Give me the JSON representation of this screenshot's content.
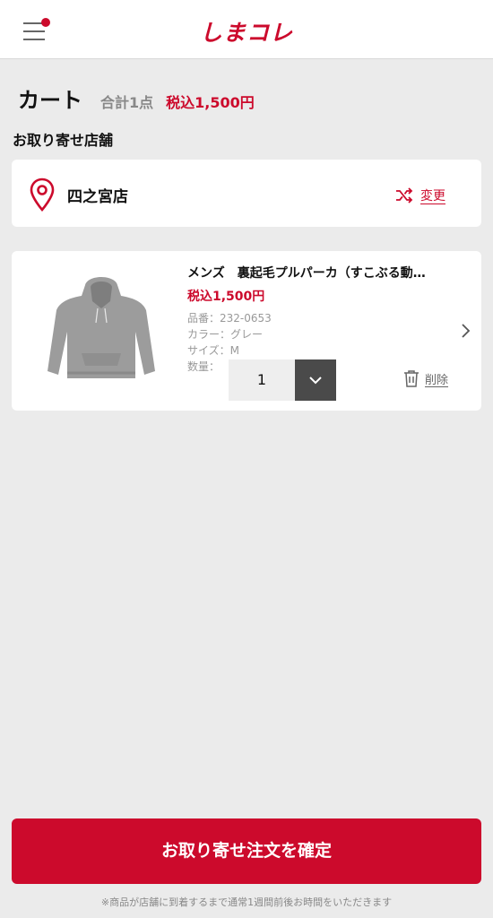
{
  "header": {
    "logo": "しまコレ",
    "menu_icon": "hamburger-menu-icon",
    "notification_dot_color": "#cc0a2c"
  },
  "cart": {
    "title": "カート",
    "count": "合計1点",
    "total": "税込1,500円"
  },
  "store_section": {
    "label": "お取り寄せ店舗",
    "store_name": "四之宮店",
    "change_label": "変更",
    "pin_icon": "location-pin-icon",
    "change_icon": "shuffle-icon"
  },
  "item": {
    "name": "メンズ　裏起毛プルパーカ（すこぶる動…",
    "price": "税込1,500円",
    "sku": "品番：232-0653",
    "color": "カラー：グレー",
    "size": "サイズ：M",
    "qty_label": "数量：",
    "qty_value": "1",
    "delete_label": "削除",
    "delete_icon": "trash-icon",
    "detail_icon": "chevron-right-icon"
  },
  "footer": {
    "confirm_label": "お取り寄せ注文を確定",
    "note": "※商品が店舗に到着するまで通常1週間前後お時間をいただきます"
  },
  "colors": {
    "accent": "#cc0a2c",
    "background": "#ebebeb",
    "card": "#ffffff"
  }
}
